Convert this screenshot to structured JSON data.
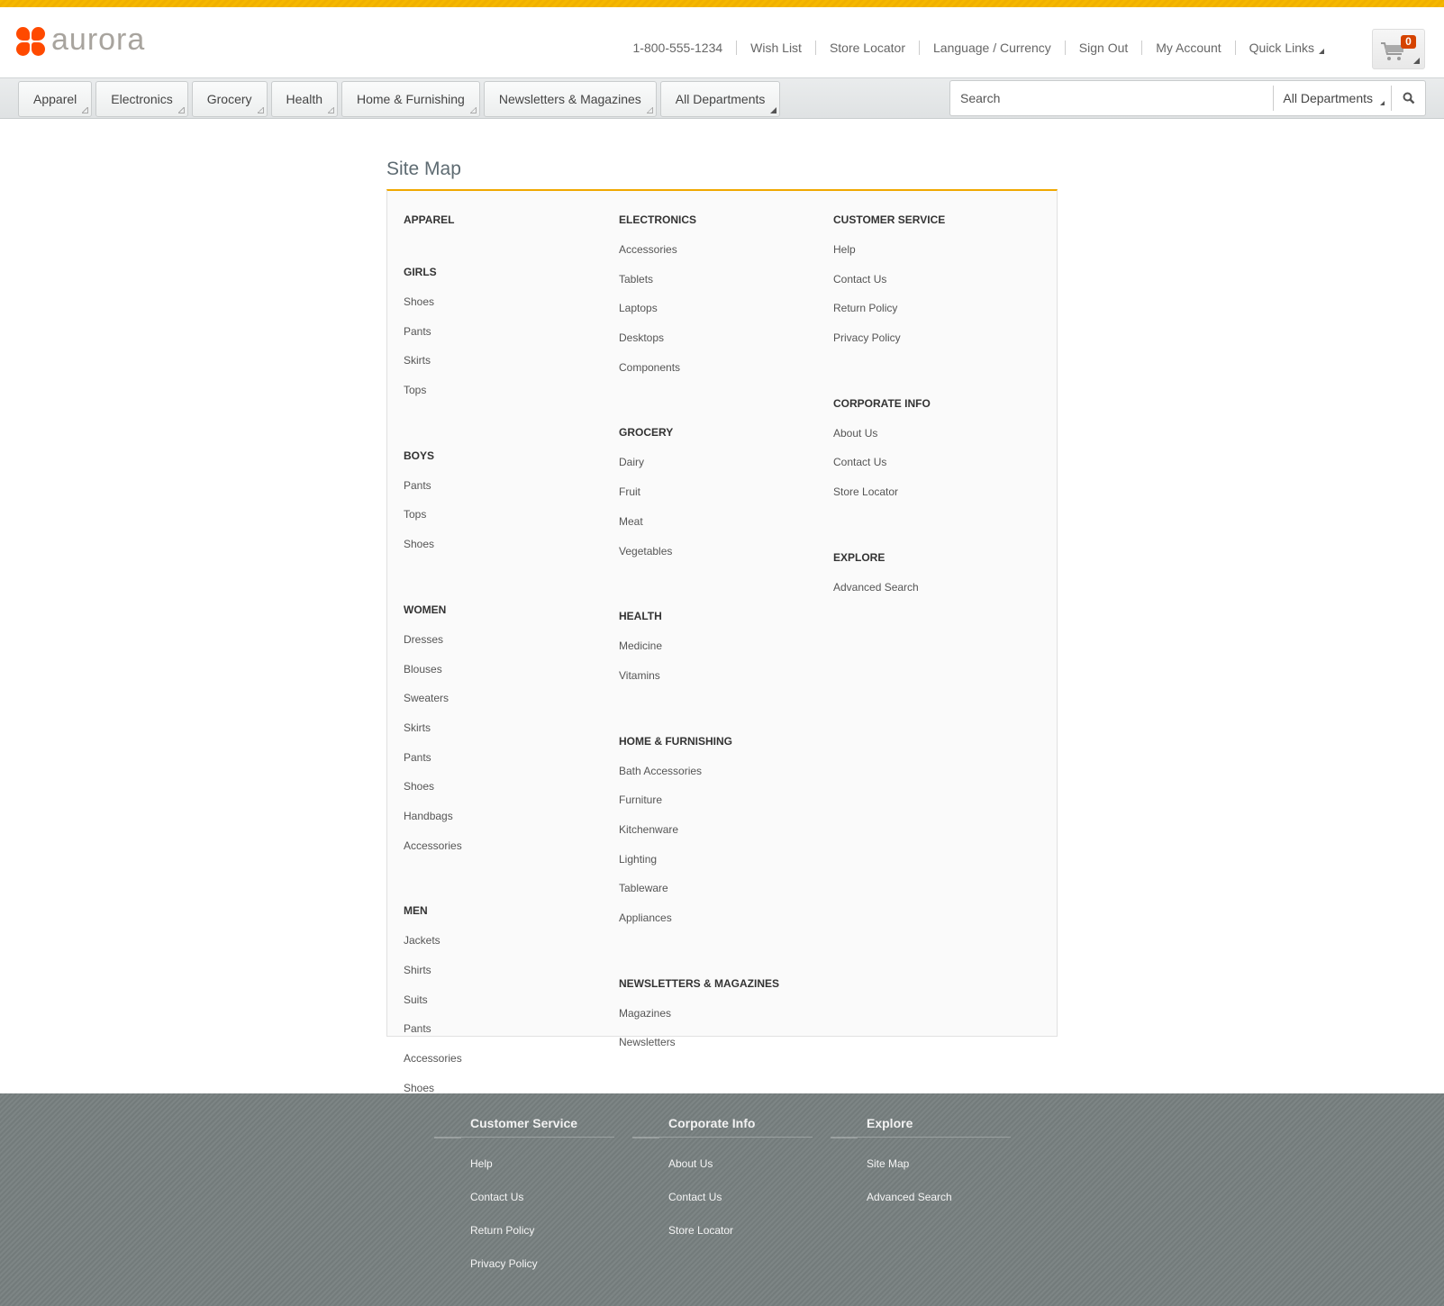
{
  "brand": {
    "name": "aurora",
    "accent": "#f0a800",
    "logo_color": "#ff4a00"
  },
  "utility_links": [
    {
      "label": "1-800-555-1234",
      "dropdown": false
    },
    {
      "label": "Wish List",
      "dropdown": false
    },
    {
      "label": "Store Locator",
      "dropdown": false
    },
    {
      "label": "Language / Currency",
      "dropdown": false
    },
    {
      "label": "Sign Out",
      "dropdown": false
    },
    {
      "label": "My Account",
      "dropdown": false
    },
    {
      "label": "Quick Links",
      "dropdown": true
    }
  ],
  "cart": {
    "count": "0",
    "icon": "shopping-cart-icon"
  },
  "departments": [
    "Apparel",
    "Electronics",
    "Grocery",
    "Health",
    "Home & Furnishing",
    "Newsletters & Magazines",
    "All Departments"
  ],
  "search": {
    "placeholder": "Search",
    "value": "",
    "department": "All Departments",
    "icon": "search-icon"
  },
  "page_title": "Site Map",
  "sitemap": {
    "col1": [
      {
        "title": "APPAREL",
        "links": []
      },
      {
        "title": "GIRLS",
        "links": [
          "Shoes",
          "Pants",
          "Skirts",
          "Tops"
        ]
      },
      {
        "title": "BOYS",
        "links": [
          "Pants",
          "Tops",
          "Shoes"
        ]
      },
      {
        "title": "WOMEN",
        "links": [
          "Dresses",
          "Blouses",
          "Sweaters",
          "Skirts",
          "Pants",
          "Shoes",
          "Handbags",
          "Accessories"
        ]
      },
      {
        "title": "MEN",
        "links": [
          "Jackets",
          "Shirts",
          "Suits",
          "Pants",
          "Accessories",
          "Shoes"
        ]
      }
    ],
    "col2": [
      {
        "title": "ELECTRONICS",
        "links": [
          "Accessories",
          "Tablets",
          "Laptops",
          "Desktops",
          "Components"
        ]
      },
      {
        "title": "GROCERY",
        "links": [
          "Dairy",
          "Fruit",
          "Meat",
          "Vegetables"
        ]
      },
      {
        "title": "HEALTH",
        "links": [
          "Medicine",
          "Vitamins"
        ]
      },
      {
        "title": "HOME & FURNISHING",
        "links": [
          "Bath Accessories",
          "Furniture",
          "Kitchenware",
          "Lighting",
          "Tableware",
          "Appliances"
        ]
      },
      {
        "title": "NEWSLETTERS & MAGAZINES",
        "links": [
          "Magazines",
          "Newsletters"
        ]
      }
    ],
    "col3": [
      {
        "title": "CUSTOMER SERVICE",
        "links": [
          "Help",
          "Contact Us",
          "Return Policy",
          "Privacy Policy"
        ]
      },
      {
        "title": "CORPORATE INFO",
        "links": [
          "About Us",
          "Contact Us",
          "Store Locator"
        ]
      },
      {
        "title": "EXPLORE",
        "links": [
          "Advanced Search"
        ]
      }
    ]
  },
  "footer": [
    {
      "title": "Customer Service",
      "links": [
        "Help",
        "Contact Us",
        "Return Policy",
        "Privacy Policy"
      ]
    },
    {
      "title": "Corporate Info",
      "links": [
        "About Us",
        "Contact Us",
        "Store Locator"
      ]
    },
    {
      "title": "Explore",
      "links": [
        "Site Map",
        "Advanced Search"
      ]
    }
  ]
}
